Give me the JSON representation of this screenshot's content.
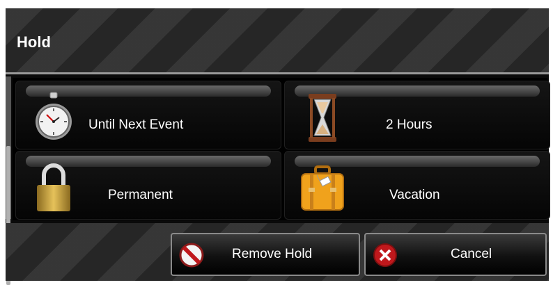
{
  "dialog": {
    "title": "Hold"
  },
  "options": [
    {
      "label": "Until Next Event",
      "icon": "stopwatch-icon"
    },
    {
      "label": "2 Hours",
      "icon": "hourglass-icon"
    },
    {
      "label": "Permanent",
      "icon": "padlock-icon"
    },
    {
      "label": "Vacation",
      "icon": "suitcase-icon"
    }
  ],
  "buttons": {
    "remove_hold": {
      "label": "Remove Hold",
      "icon": "no-entry-icon"
    },
    "cancel": {
      "label": "Cancel",
      "icon": "close-icon"
    }
  },
  "colors": {
    "background": "#2a2a2a",
    "text": "#ffffff",
    "cancel_red": "#c0181c"
  }
}
